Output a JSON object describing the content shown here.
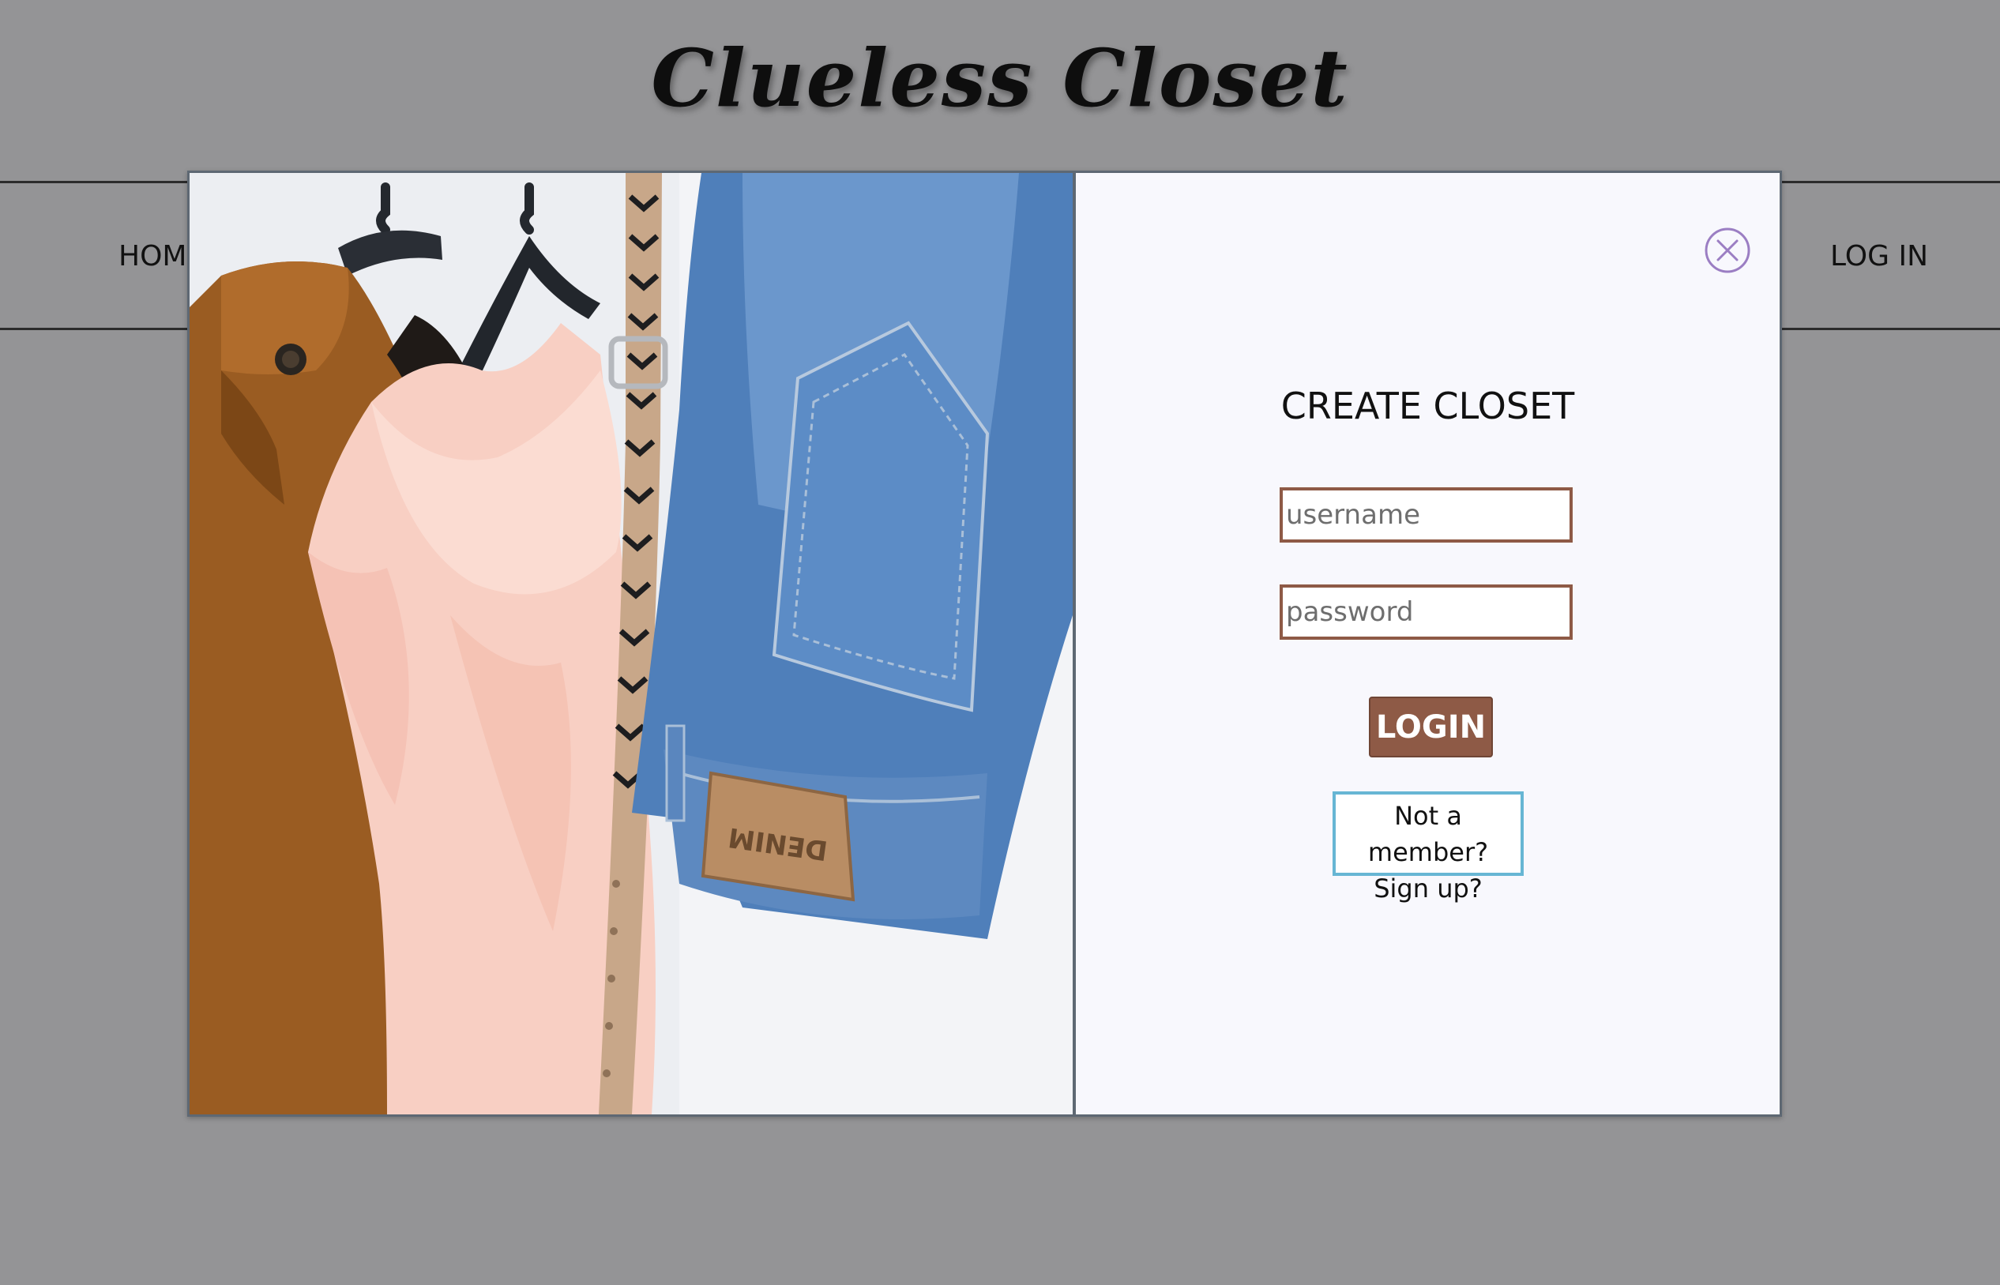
{
  "header": {
    "site_title": "Clueless Closet"
  },
  "nav": {
    "home_label": "HOME",
    "login_label": "LOG IN"
  },
  "modal": {
    "title": "CREATE CLOSET",
    "username_placeholder": "username",
    "password_placeholder": "password",
    "login_button": "LOGIN",
    "signup_line1": "Not a member?",
    "signup_line2": "Sign up?",
    "close_icon": "close-circle-icon",
    "image_label": "DENIM",
    "image_subject": "clothes-on-hangers-photo"
  },
  "colors": {
    "page_background": "#949496",
    "modal_background": "#f8f8fd",
    "accent_brown": "#8e5a46",
    "signup_border": "#67b6d4",
    "close_icon": "#9b7ec3"
  }
}
